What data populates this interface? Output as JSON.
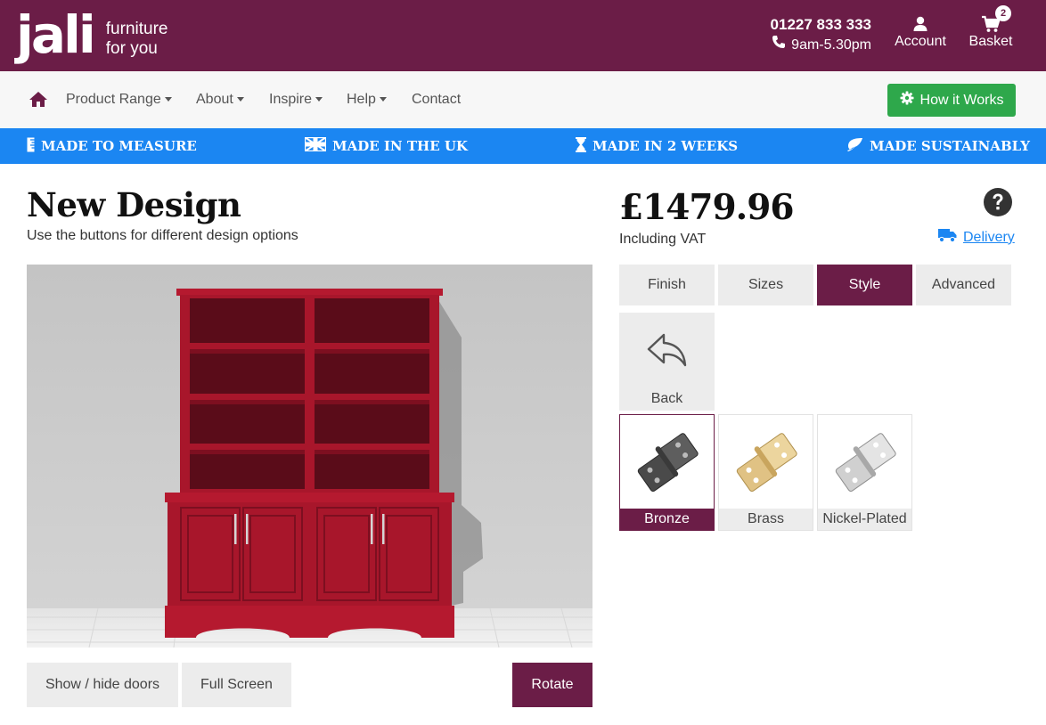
{
  "header": {
    "logo_text": "jali",
    "tagline_1": "furniture",
    "tagline_2": "for you",
    "phone": "01227 833 333",
    "hours": "9am-5.30pm",
    "account_label": "Account",
    "basket_label": "Basket",
    "basket_count": "2",
    "bg_color": "#6b1d47"
  },
  "nav": {
    "items": [
      {
        "label": "Product Range",
        "dropdown": true
      },
      {
        "label": "About",
        "dropdown": true
      },
      {
        "label": "Inspire",
        "dropdown": true
      },
      {
        "label": "Help",
        "dropdown": true
      },
      {
        "label": "Contact",
        "dropdown": false
      }
    ],
    "cta_label": "How it Works",
    "cta_color": "#2ea84b"
  },
  "strip": {
    "items": [
      {
        "label": "MADE TO MEASURE",
        "icon": "ruler-icon"
      },
      {
        "label": "MADE IN THE UK",
        "icon": "uk-flag-icon"
      },
      {
        "label": "MADE IN 2 WEEKS",
        "icon": "hourglass-icon"
      },
      {
        "label": "MADE SUSTAINABLY",
        "icon": "leaf-icon"
      }
    ],
    "color": "#1b86f2"
  },
  "design": {
    "title": "New Design",
    "subtitle": "Use the buttons for different design options",
    "show_hide_label": "Show / hide doors",
    "fullscreen_label": "Full Screen",
    "rotate_label": "Rotate"
  },
  "pricing": {
    "price": "£1479.96",
    "vat_note": "Including VAT",
    "delivery_label": "Delivery"
  },
  "tabs": [
    {
      "label": "Finish",
      "active": false
    },
    {
      "label": "Sizes",
      "active": false
    },
    {
      "label": "Style",
      "active": true
    },
    {
      "label": "Advanced",
      "active": false
    }
  ],
  "options": {
    "back_label": "Back",
    "items": [
      {
        "label": "Bronze",
        "selected": true,
        "color": "#4a4a4a"
      },
      {
        "label": "Brass",
        "selected": false,
        "color": "#d9b978"
      },
      {
        "label": "Nickel-Plated",
        "selected": false,
        "color": "#c7c7c7"
      }
    ]
  }
}
